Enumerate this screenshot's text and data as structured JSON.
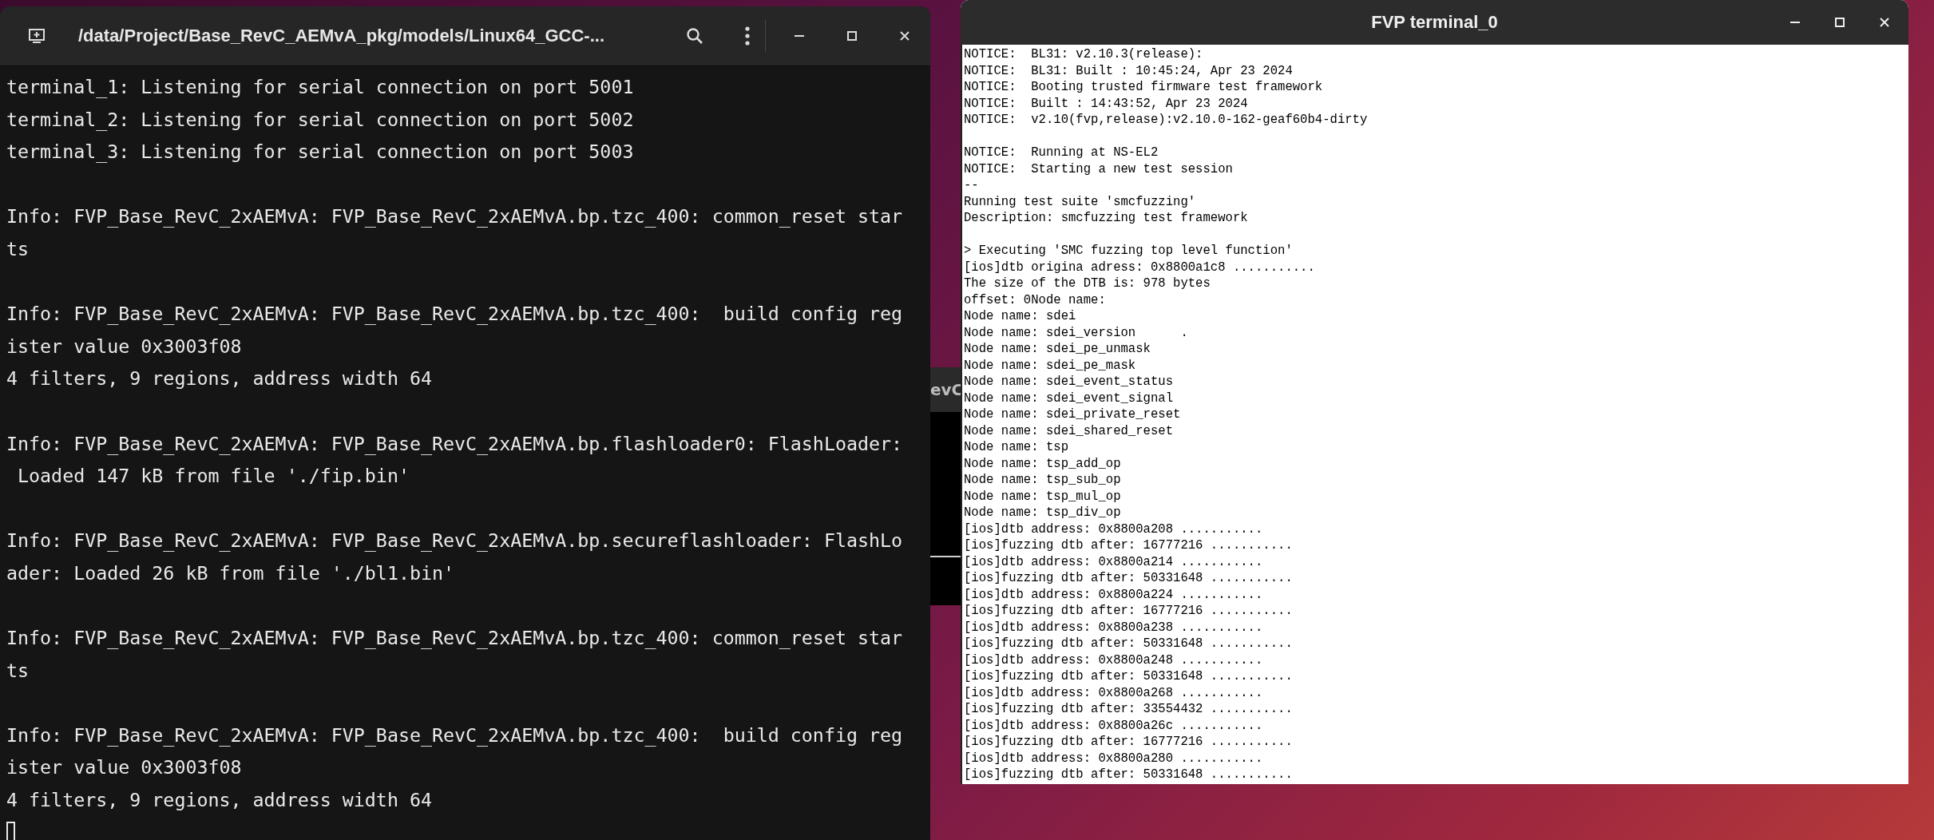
{
  "terminal_window": {
    "title": "/data/Project/Base_RevC_AEMvA_pkg/models/Linux64_GCC-...",
    "blocks": [
      [
        "terminal_1: Listening for serial connection on port 5001",
        "terminal_2: Listening for serial connection on port 5002",
        "terminal_3: Listening for serial connection on port 5003"
      ],
      [
        "Info: FVP_Base_RevC_2xAEMvA: FVP_Base_RevC_2xAEMvA.bp.tzc_400: common_reset star",
        "ts"
      ],
      [
        "Info: FVP_Base_RevC_2xAEMvA: FVP_Base_RevC_2xAEMvA.bp.tzc_400:  build config reg",
        "ister value 0x3003f08",
        "4 filters, 9 regions, address width 64"
      ],
      [
        "Info: FVP_Base_RevC_2xAEMvA: FVP_Base_RevC_2xAEMvA.bp.flashloader0: FlashLoader:",
        " Loaded 147 kB from file './fip.bin'"
      ],
      [
        "Info: FVP_Base_RevC_2xAEMvA: FVP_Base_RevC_2xAEMvA.bp.secureflashloader: FlashLo",
        "ader: Loaded 26 kB from file './bl1.bin'"
      ],
      [
        "Info: FVP_Base_RevC_2xAEMvA: FVP_Base_RevC_2xAEMvA.bp.tzc_400: common_reset star",
        "ts"
      ],
      [
        "Info: FVP_Base_RevC_2xAEMvA: FVP_Base_RevC_2xAEMvA.bp.tzc_400:  build config reg",
        "ister value 0x3003f08",
        "4 filters, 9 regions, address width 64"
      ]
    ]
  },
  "background_window": {
    "title_fragment": "evC"
  },
  "fvp_window": {
    "title": "FVP terminal_0",
    "blocks": [
      [
        "NOTICE:  BL31: v2.10.3(release):",
        "NOTICE:  BL31: Built : 10:45:24, Apr 23 2024",
        "NOTICE:  Booting trusted firmware test framework",
        "NOTICE:  Built : 14:43:52, Apr 23 2024",
        "NOTICE:  v2.10(fvp,release):v2.10.0-162-geaf60b4-dirty"
      ],
      [
        "NOTICE:  Running at NS-EL2",
        "NOTICE:  Starting a new test session",
        "--",
        "Running test suite 'smcfuzzing'",
        "Description: smcfuzzing test framework"
      ],
      [
        "> Executing 'SMC fuzzing top level function'",
        "[ios]dtb origina adress: 0x8800a1c8 ...........",
        "The size of the DTB is: 978 bytes",
        "offset: 0Node name: ",
        "Node name: sdei",
        "Node name: sdei_version      .",
        "Node name: sdei_pe_unmask",
        "Node name: sdei_pe_mask",
        "Node name: sdei_event_status",
        "Node name: sdei_event_signal",
        "Node name: sdei_private_reset",
        "Node name: sdei_shared_reset",
        "Node name: tsp",
        "Node name: tsp_add_op",
        "Node name: tsp_sub_op",
        "Node name: tsp_mul_op",
        "Node name: tsp_div_op",
        "[ios]dtb address: 0x8800a208 ...........",
        "[ios]fuzzing dtb after: 16777216 ...........",
        "[ios]dtb address: 0x8800a214 ...........",
        "[ios]fuzzing dtb after: 50331648 ...........",
        "[ios]dtb address: 0x8800a224 ...........",
        "[ios]fuzzing dtb after: 16777216 ...........",
        "[ios]dtb address: 0x8800a238 ...........",
        "[ios]fuzzing dtb after: 50331648 ...........",
        "[ios]dtb address: 0x8800a248 ...........",
        "[ios]fuzzing dtb after: 50331648 ...........",
        "[ios]dtb address: 0x8800a268 ...........",
        "[ios]fuzzing dtb after: 33554432 ...........",
        "[ios]dtb address: 0x8800a26c ...........",
        "[ios]fuzzing dtb after: 16777216 ...........",
        "[ios]dtb address: 0x8800a280 ...........",
        "[ios]fuzzing dtb after: 50331648 ..........."
      ]
    ]
  }
}
